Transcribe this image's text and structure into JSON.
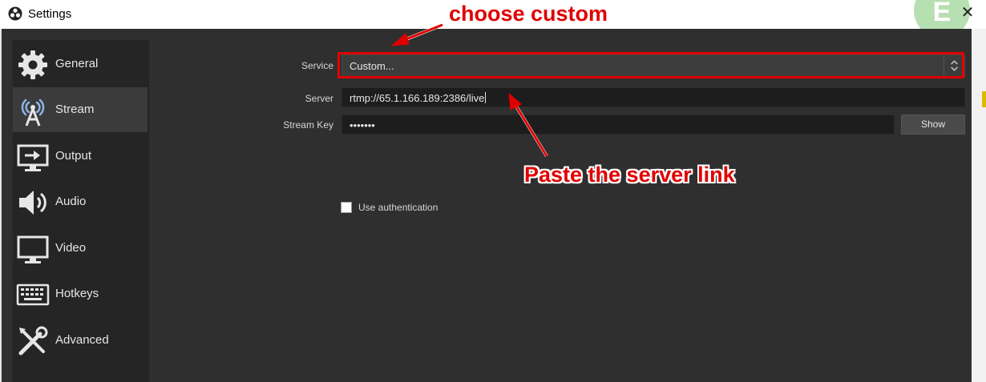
{
  "window": {
    "title": "Settings",
    "close_glyph": "✕",
    "logo_letter": "E"
  },
  "sidebar": {
    "items": [
      {
        "label": "General",
        "icon": "gear-icon"
      },
      {
        "label": "Stream",
        "icon": "antenna-icon",
        "active": true
      },
      {
        "label": "Output",
        "icon": "output-icon"
      },
      {
        "label": "Audio",
        "icon": "speaker-icon"
      },
      {
        "label": "Video",
        "icon": "monitor-icon"
      },
      {
        "label": "Hotkeys",
        "icon": "keyboard-icon"
      },
      {
        "label": "Advanced",
        "icon": "tools-icon"
      }
    ]
  },
  "stream": {
    "service_label": "Service",
    "service_value": "Custom...",
    "server_label": "Server",
    "server_value": "rtmp://65.1.166.189:2386/live",
    "stream_key_label": "Stream Key",
    "stream_key_value": "•••••••",
    "show_button": "Show",
    "use_auth_label": "Use authentication",
    "use_auth_checked": false
  },
  "annotations": {
    "top_text": "choose custom",
    "mid_text": "Paste the server link",
    "color": "#e00000"
  },
  "colors": {
    "window_bg": "#2f2f2f",
    "sidebar_bg": "#252525",
    "active_item": "#3b3b3b",
    "input_bg": "#1d1d1d"
  }
}
